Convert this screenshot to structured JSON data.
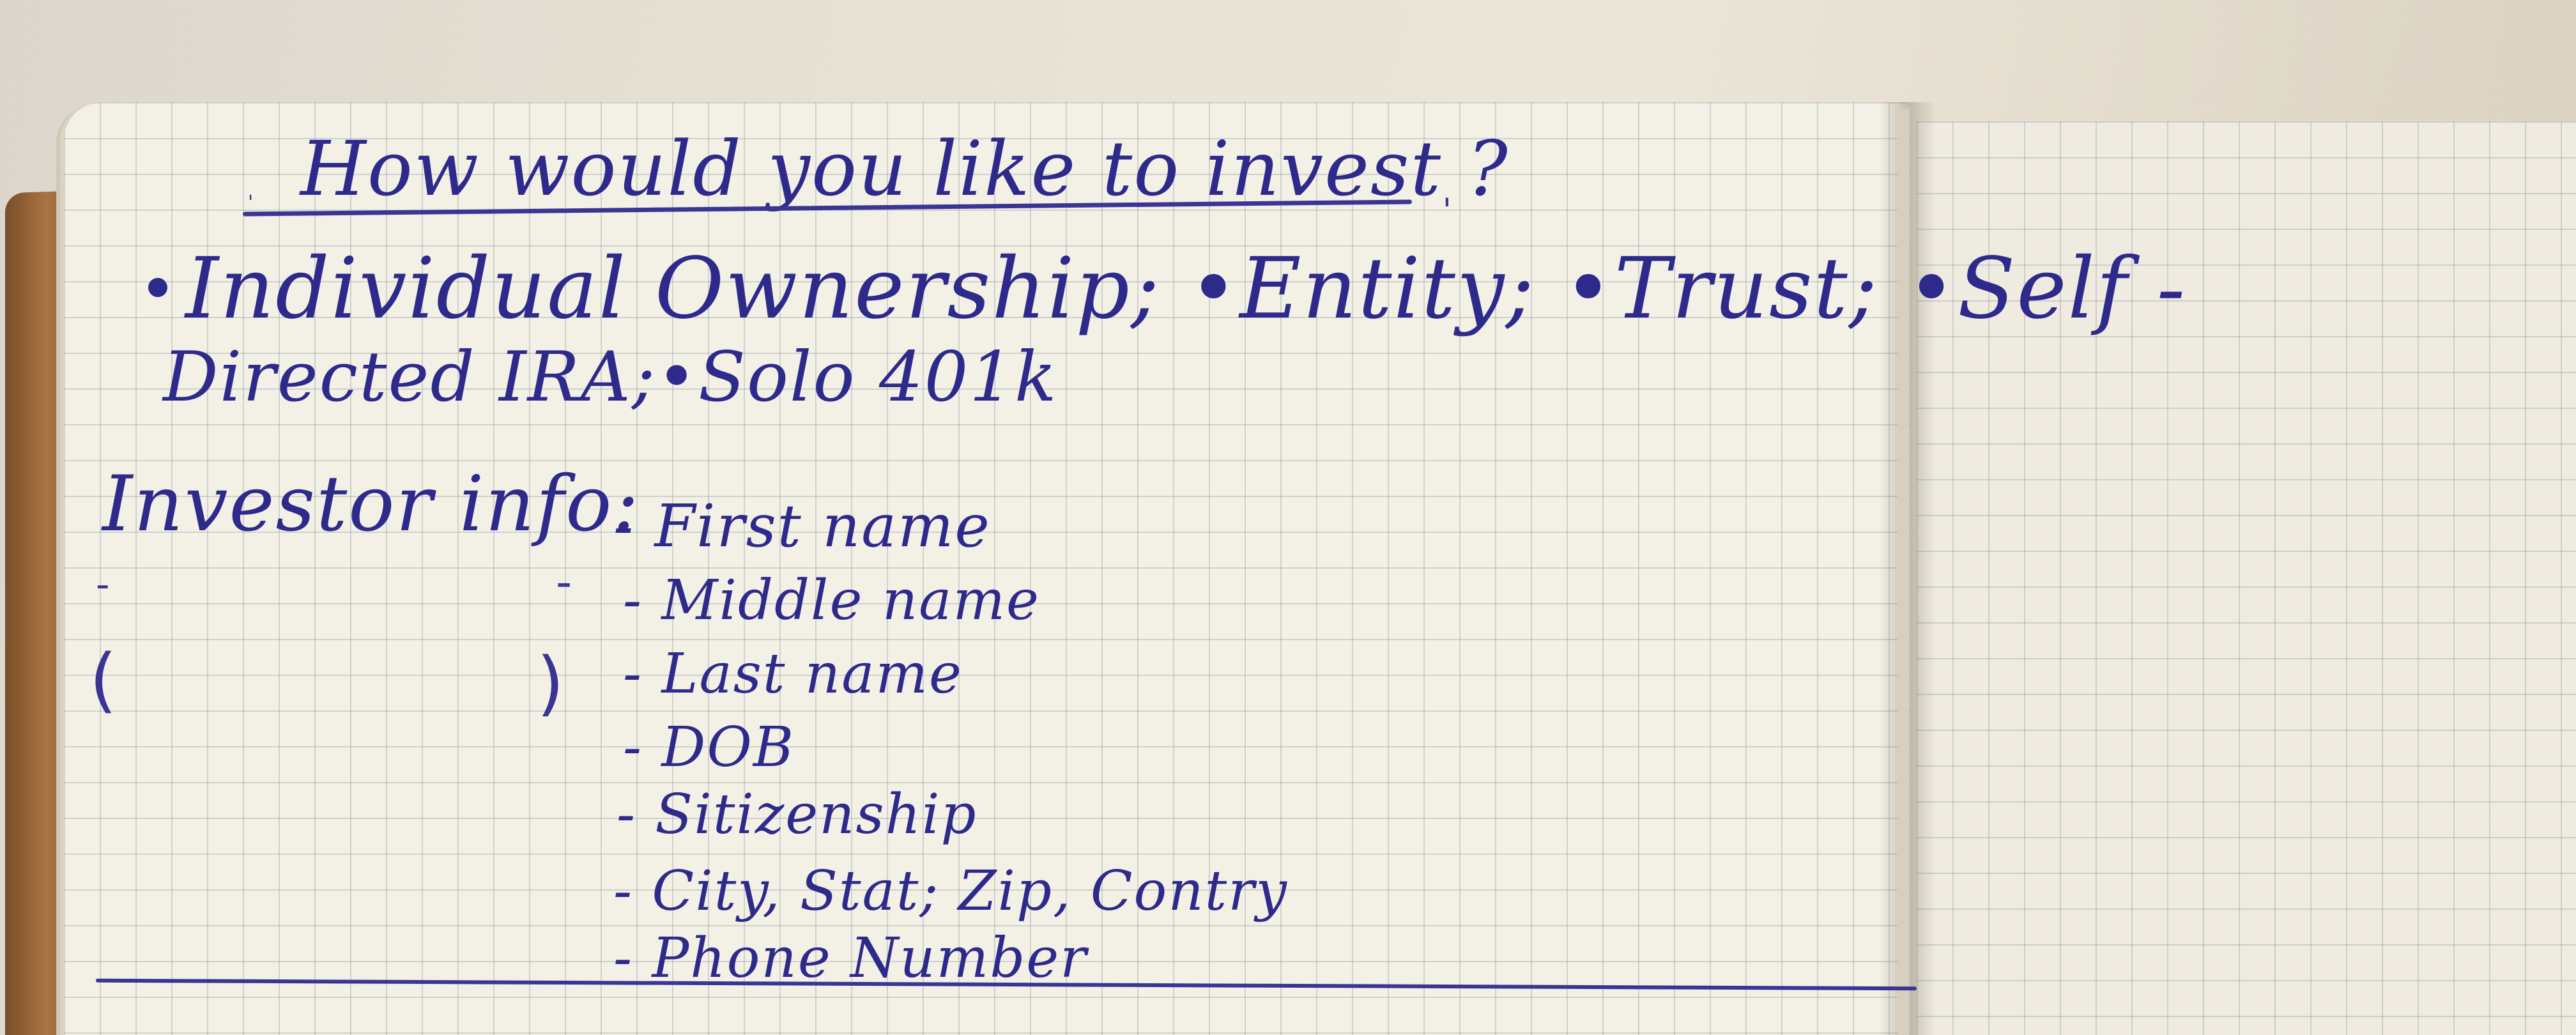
{
  "notebook": {
    "heading": "How would you like to invest ?",
    "options_line1": "Individual Ownership; •Entity; •Trust; •Self -",
    "options_line2": "Directed IRA;•Solo 401k",
    "investor_label": "Investor info:",
    "fields": [
      "- First name",
      "- Middle name",
      "- Last name",
      "- DOB",
      "- Sitizenship",
      "- City, Stat; Zip, Contry",
      "- Phone Number"
    ]
  },
  "colors": {
    "ink": "#2e2a8c",
    "paper": "#f3f0e6",
    "grid": "#8a96a0",
    "cover": "#a87443"
  }
}
